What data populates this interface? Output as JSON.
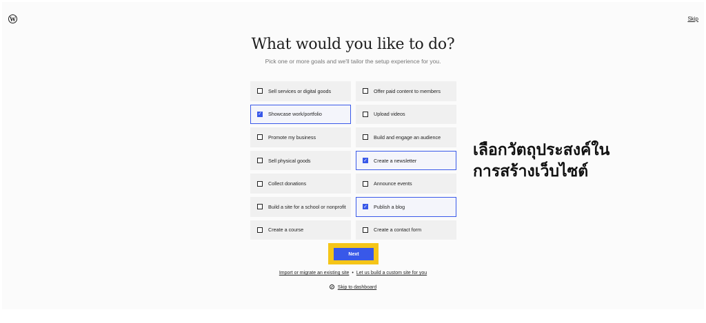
{
  "header": {
    "logo_glyph": "W",
    "skip_label": "Skip"
  },
  "main": {
    "title": "What would you like to do?",
    "subtitle": "Pick one or more goals and we'll tailor the setup experience for you.",
    "goals": [
      {
        "label": "Sell services or digital goods",
        "checked": false
      },
      {
        "label": "Offer paid content to members",
        "checked": false
      },
      {
        "label": "Showcase work/portfolio",
        "checked": true
      },
      {
        "label": "Upload videos",
        "checked": false
      },
      {
        "label": "Promote my business",
        "checked": false
      },
      {
        "label": "Build and engage an audience",
        "checked": false
      },
      {
        "label": "Sell physical goods",
        "checked": false
      },
      {
        "label": "Create a newsletter",
        "checked": true
      },
      {
        "label": "Collect donations",
        "checked": false
      },
      {
        "label": "Announce events",
        "checked": false
      },
      {
        "label": "Build a site for a school or nonprofit",
        "checked": false
      },
      {
        "label": "Publish a blog",
        "checked": true
      },
      {
        "label": "Create a course",
        "checked": false
      },
      {
        "label": "Create a contact form",
        "checked": false
      }
    ],
    "next_label": "Next",
    "import_link": "Import or migrate an existing site",
    "separator": "•",
    "custom_link": "Let us build a custom site for you",
    "dashboard_link": "Skip to dashboard"
  },
  "annotation": {
    "line1": "เลือกวัตถุประสงค์ใน",
    "line2": "การสร้างเว็บไซต์"
  },
  "colors": {
    "accent": "#3858e9",
    "highlight": "#f5c518"
  }
}
